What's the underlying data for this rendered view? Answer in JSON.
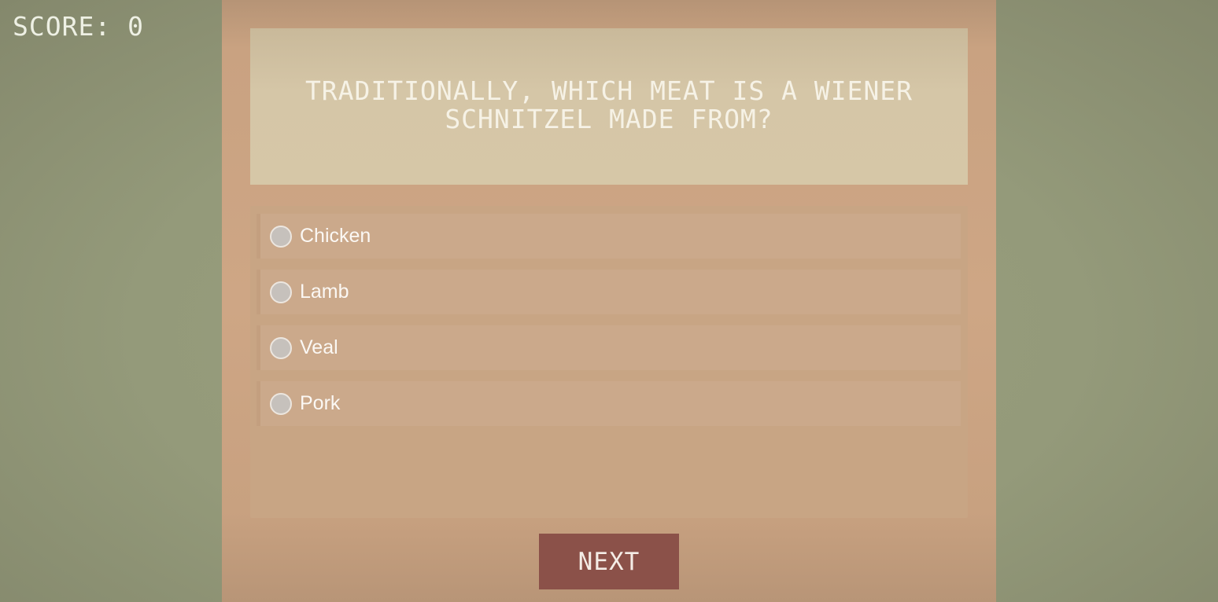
{
  "score": {
    "label": "SCORE: 0"
  },
  "question": {
    "text": "TRADITIONALLY, WHICH MEAT IS A WIENER SCHNITZEL MADE FROM?"
  },
  "answers": [
    {
      "label": "Chicken"
    },
    {
      "label": "Lamb"
    },
    {
      "label": "Veal"
    },
    {
      "label": "Pork"
    }
  ],
  "next_button": {
    "label": "NEXT"
  },
  "colors": {
    "background": "#949a7a",
    "panel": "#cea685",
    "question_box": "#d5c6a7",
    "answer_row": "#cba98b",
    "next_button": "#8b5149"
  }
}
